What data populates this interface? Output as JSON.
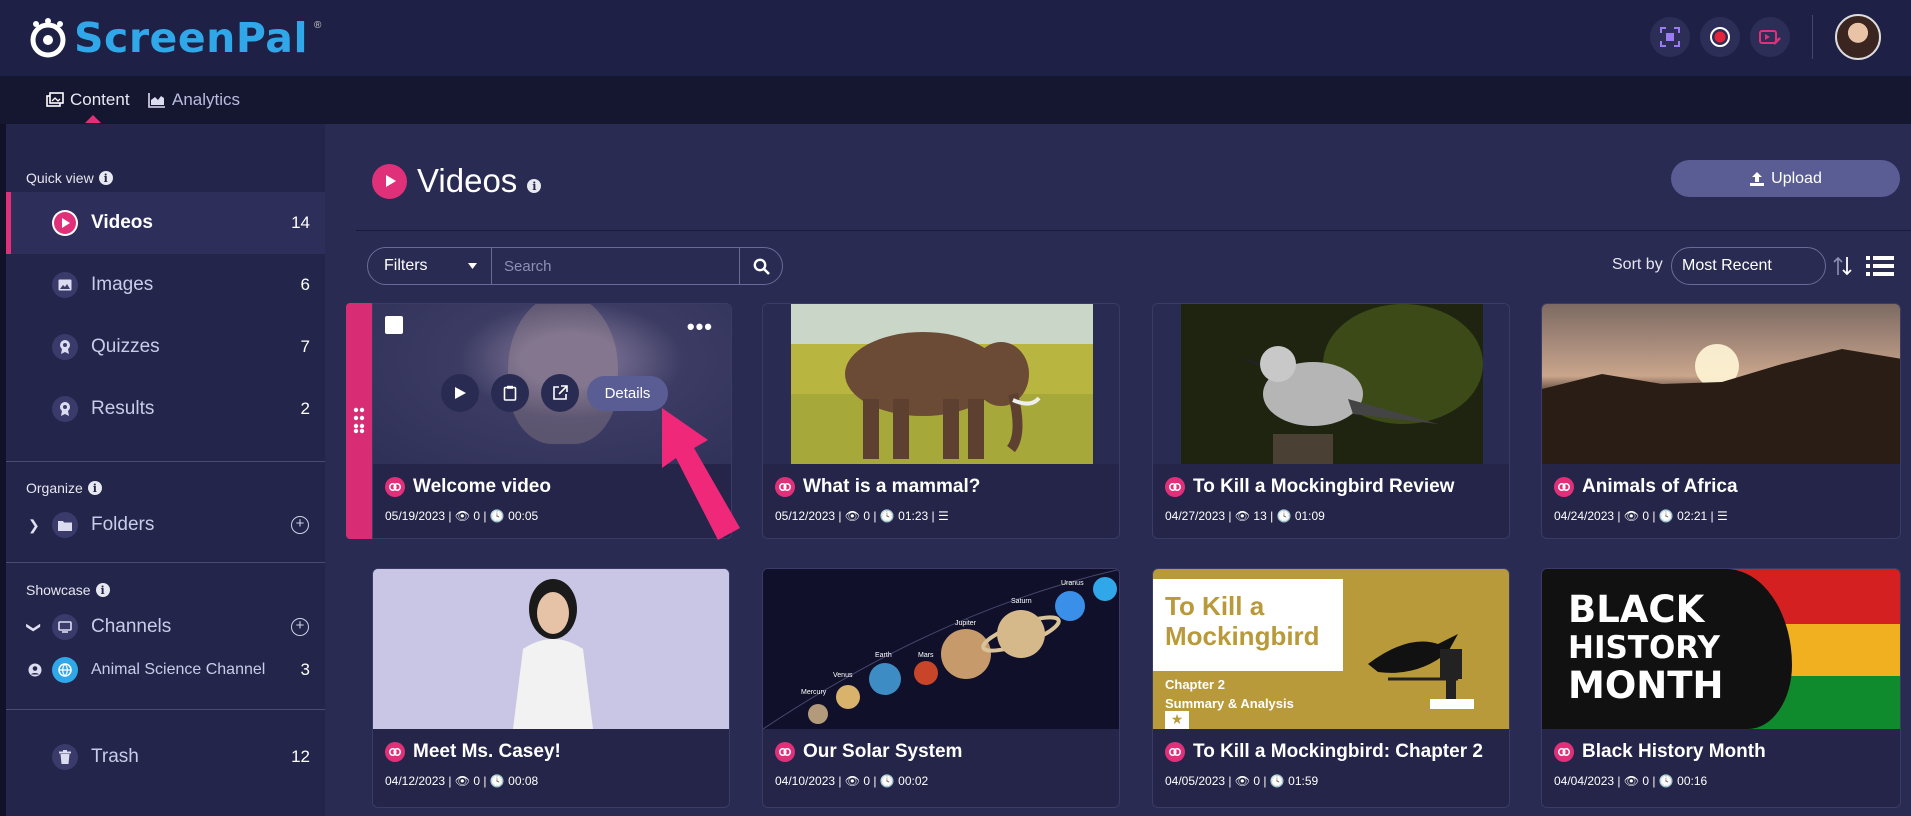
{
  "app": {
    "brand": "ScreenPal",
    "brand_mark": "®"
  },
  "top_actions": [
    {
      "icon": "screenshot-icon"
    },
    {
      "icon": "record-icon"
    },
    {
      "icon": "video-editor-icon"
    }
  ],
  "tabs": [
    {
      "label": "Content",
      "icon": "content-icon",
      "active": true
    },
    {
      "label": "Analytics",
      "icon": "analytics-icon",
      "active": false
    }
  ],
  "sidebar": {
    "quick_view_title": "Quick view",
    "quick_view": [
      {
        "label": "Videos",
        "count": "14",
        "icon": "play-icon",
        "active": true
      },
      {
        "label": "Images",
        "count": "6",
        "icon": "image-icon"
      },
      {
        "label": "Quizzes",
        "count": "7",
        "icon": "quiz-icon"
      },
      {
        "label": "Results",
        "count": "2",
        "icon": "results-icon"
      }
    ],
    "organize_title": "Organize",
    "folders_label": "Folders",
    "showcase_title": "Showcase",
    "channels_label": "Channels",
    "channel": {
      "label": "Animal Science Channel",
      "count": "3"
    },
    "trash": {
      "label": "Trash",
      "count": "12"
    }
  },
  "main": {
    "title": "Videos",
    "upload_label": "Upload",
    "filters_label": "Filters",
    "search_placeholder": "Search",
    "sort_label": "Sort by",
    "sort_value": "Most Recent",
    "details_label": "Details"
  },
  "videos": [
    {
      "title": "Welcome video",
      "meta": "05/19/2023 | 👁 0 | 🕓 00:05"
    },
    {
      "title": "What is a mammal?",
      "meta": "05/12/2023 | 👁 0 | 🕓 01:23 | ☰"
    },
    {
      "title": "To Kill a Mockingbird Review",
      "meta": "04/27/2023 | 👁 13 | 🕓 01:09"
    },
    {
      "title": "Animals of Africa",
      "meta": "04/24/2023 | 👁 0 | 🕓 02:21 | ☰"
    },
    {
      "title": "Meet Ms. Casey!",
      "meta": "04/12/2023 | 👁 0 | 🕓 00:08"
    },
    {
      "title": "Our Solar System",
      "meta": "04/10/2023 | 👁 0 | 🕓 00:02"
    },
    {
      "title": "To Kill a Mockingbird: Chapter 2",
      "meta": "04/05/2023 | 👁 0 | 🕓 01:59"
    },
    {
      "title": "Black History Month",
      "meta": "04/04/2023 | 👁 0 | 🕓 00:16"
    }
  ],
  "thumb_text": {
    "mockingbird_line1": "To Kill a",
    "mockingbird_line2": "Mockingbird",
    "chapter": "Chapter 2",
    "summary": "Summary & Analysis",
    "bhm1": "BLACK",
    "bhm2": "HISTORY",
    "bhm3": "MONTH",
    "planets": [
      "Mercury",
      "Venus",
      "Earth",
      "Mars",
      "Jupiter",
      "Saturn",
      "Uranus"
    ]
  },
  "colors": {
    "accent": "#e0307a",
    "brand_blue": "#2fa7e8",
    "bg": "#2a2b52"
  }
}
